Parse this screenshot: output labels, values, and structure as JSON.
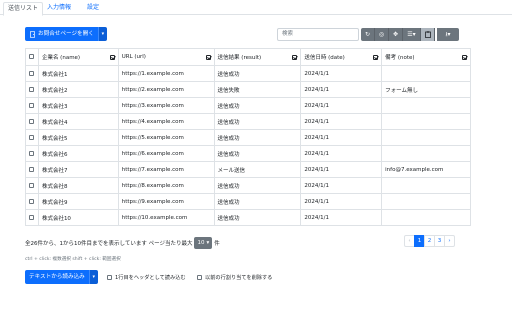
{
  "tabs": [
    {
      "label": "送信リスト",
      "active": true
    },
    {
      "label": "入力情報",
      "active": false
    },
    {
      "label": "設定",
      "active": false
    }
  ],
  "open_form_button": {
    "label": "お問合せページを開く",
    "icon": "door-icon",
    "caret": "▾"
  },
  "search": {
    "placeholder": "検索"
  },
  "toolbar": {
    "buttons": [
      {
        "name": "refresh-icon",
        "glyph": "↻"
      },
      {
        "name": "toggle-view-icon",
        "glyph": "◎"
      },
      {
        "name": "fullscreen-icon",
        "glyph": "✥"
      },
      {
        "name": "columns-icon",
        "glyph": "☰▾"
      },
      {
        "name": "clipboard-icon",
        "glyph": "📋"
      },
      {
        "name": "export-icon",
        "glyph": "⭳▾"
      }
    ]
  },
  "table": {
    "columns": [
      "企業名 (name)",
      "URL (url)",
      "送信結果 (result)",
      "送信日時 (date)",
      "備考 (note)"
    ],
    "rows": [
      {
        "name": "株式会社1",
        "url": "https://1.example.com",
        "result": "送信成功",
        "date": "2024/1/1",
        "note": ""
      },
      {
        "name": "株式会社2",
        "url": "https://2.example.com",
        "result": "送信失敗",
        "date": "2024/1/1",
        "note": "フォーム無し"
      },
      {
        "name": "株式会社3",
        "url": "https://3.example.com",
        "result": "送信成功",
        "date": "2024/1/1",
        "note": ""
      },
      {
        "name": "株式会社4",
        "url": "https://4.example.com",
        "result": "送信成功",
        "date": "2024/1/1",
        "note": ""
      },
      {
        "name": "株式会社5",
        "url": "https://5.example.com",
        "result": "送信成功",
        "date": "2024/1/1",
        "note": ""
      },
      {
        "name": "株式会社6",
        "url": "https://6.example.com",
        "result": "送信成功",
        "date": "2024/1/1",
        "note": ""
      },
      {
        "name": "株式会社7",
        "url": "https://7.example.com",
        "result": "メール送信",
        "date": "2024/1/1",
        "note": "info@7.example.com"
      },
      {
        "name": "株式会社8",
        "url": "https://8.example.com",
        "result": "送信成功",
        "date": "2024/1/1",
        "note": ""
      },
      {
        "name": "株式会社9",
        "url": "https://9.example.com",
        "result": "送信成功",
        "date": "2024/1/1",
        "note": ""
      },
      {
        "name": "株式会社10",
        "url": "https://10.example.com",
        "result": "送信成功",
        "date": "2024/1/1",
        "note": ""
      }
    ]
  },
  "summary": {
    "text_before": "全26件から、1から10件目までを表示しています ページ当たり最大",
    "page_size": "10",
    "caret": "▾",
    "text_after": "件"
  },
  "pagination": {
    "prev": "‹",
    "pages": [
      "1",
      "2",
      "3"
    ],
    "next": "›",
    "current": "1"
  },
  "hint": "ctrl + click: 複数選択 shift + click: 範囲選択",
  "import_button": {
    "label": "テキストから読み込み",
    "caret": "▾"
  },
  "options": [
    {
      "label": "1行目をヘッダとして読み込む",
      "checked": false
    },
    {
      "label": "以前の行割り当てを削除する",
      "checked": false
    }
  ],
  "colors": {
    "primary": "#0d6efd",
    "secondary": "#6c757d",
    "border": "#dee2e6"
  }
}
